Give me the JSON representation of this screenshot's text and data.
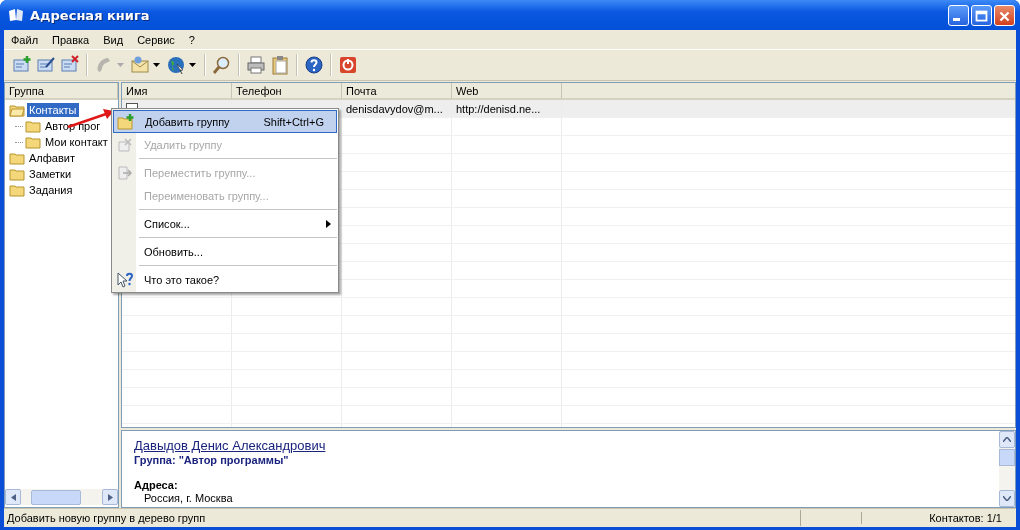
{
  "window": {
    "title": "Адресная книга"
  },
  "menu": [
    "Файл",
    "Правка",
    "Вид",
    "Сервис",
    "?"
  ],
  "toolbar": [
    {
      "kind": "button",
      "disabled": false,
      "dropdown": false
    },
    {
      "kind": "button",
      "disabled": false,
      "dropdown": false
    },
    {
      "kind": "button",
      "disabled": false,
      "dropdown": false
    },
    {
      "kind": "separator"
    },
    {
      "kind": "button",
      "disabled": true,
      "dropdown": true
    },
    {
      "kind": "button",
      "disabled": false,
      "dropdown": true
    },
    {
      "kind": "button",
      "disabled": false,
      "dropdown": true
    },
    {
      "kind": "separator"
    },
    {
      "kind": "button",
      "disabled": false,
      "dropdown": false
    },
    {
      "kind": "separator"
    },
    {
      "kind": "button",
      "disabled": false,
      "dropdown": false
    },
    {
      "kind": "button",
      "disabled": false,
      "dropdown": false
    },
    {
      "kind": "separator"
    },
    {
      "kind": "button",
      "disabled": false,
      "dropdown": false
    },
    {
      "kind": "separator"
    },
    {
      "kind": "button",
      "disabled": false,
      "dropdown": false
    }
  ],
  "tree": {
    "header": "Группа",
    "items": [
      {
        "label": "Контакты",
        "selected": true,
        "expanded": true,
        "children": [
          {
            "label": "Автор прог",
            "selected": false
          },
          {
            "label": "Мои контакт",
            "selected": false
          }
        ]
      },
      {
        "label": "Алфавит",
        "selected": false
      },
      {
        "label": "Заметки",
        "selected": false
      },
      {
        "label": "Задания",
        "selected": false
      }
    ]
  },
  "table": {
    "columns": [
      "Имя",
      "Телефон",
      "Почта",
      "Web"
    ],
    "rows": [
      {
        "cells": [
          "",
          "",
          "denisdavydov@m...",
          "http://denisd.ne..."
        ]
      }
    ]
  },
  "context_menu": [
    {
      "kind": "item",
      "label": "Добавить группу",
      "shortcut": "Shift+Ctrl+G",
      "selected": true,
      "disabled": false
    },
    {
      "kind": "item",
      "label": "Удалить группу",
      "selected": false,
      "disabled": true
    },
    {
      "kind": "separator"
    },
    {
      "kind": "item",
      "label": "Переместить группу...",
      "selected": false,
      "disabled": true
    },
    {
      "kind": "item",
      "label": "Переименовать группу...",
      "selected": false,
      "disabled": true
    },
    {
      "kind": "separator"
    },
    {
      "kind": "item",
      "label": "Список...",
      "selected": false,
      "disabled": false,
      "submenu": true
    },
    {
      "kind": "separator"
    },
    {
      "kind": "item",
      "label": "Обновить...",
      "selected": false,
      "disabled": false
    },
    {
      "kind": "separator"
    },
    {
      "kind": "item",
      "label": "Что это такое?",
      "selected": false,
      "disabled": false
    }
  ],
  "preview": {
    "name": "Давыдов Денис Александрович",
    "group": "Группа: \"Автор программы\"",
    "section": "Адреса:",
    "address": "Россия, г. Москва"
  },
  "status_bar": {
    "message": "Добавить новую группу в дерево групп",
    "count": "Контактов: 1/1"
  }
}
